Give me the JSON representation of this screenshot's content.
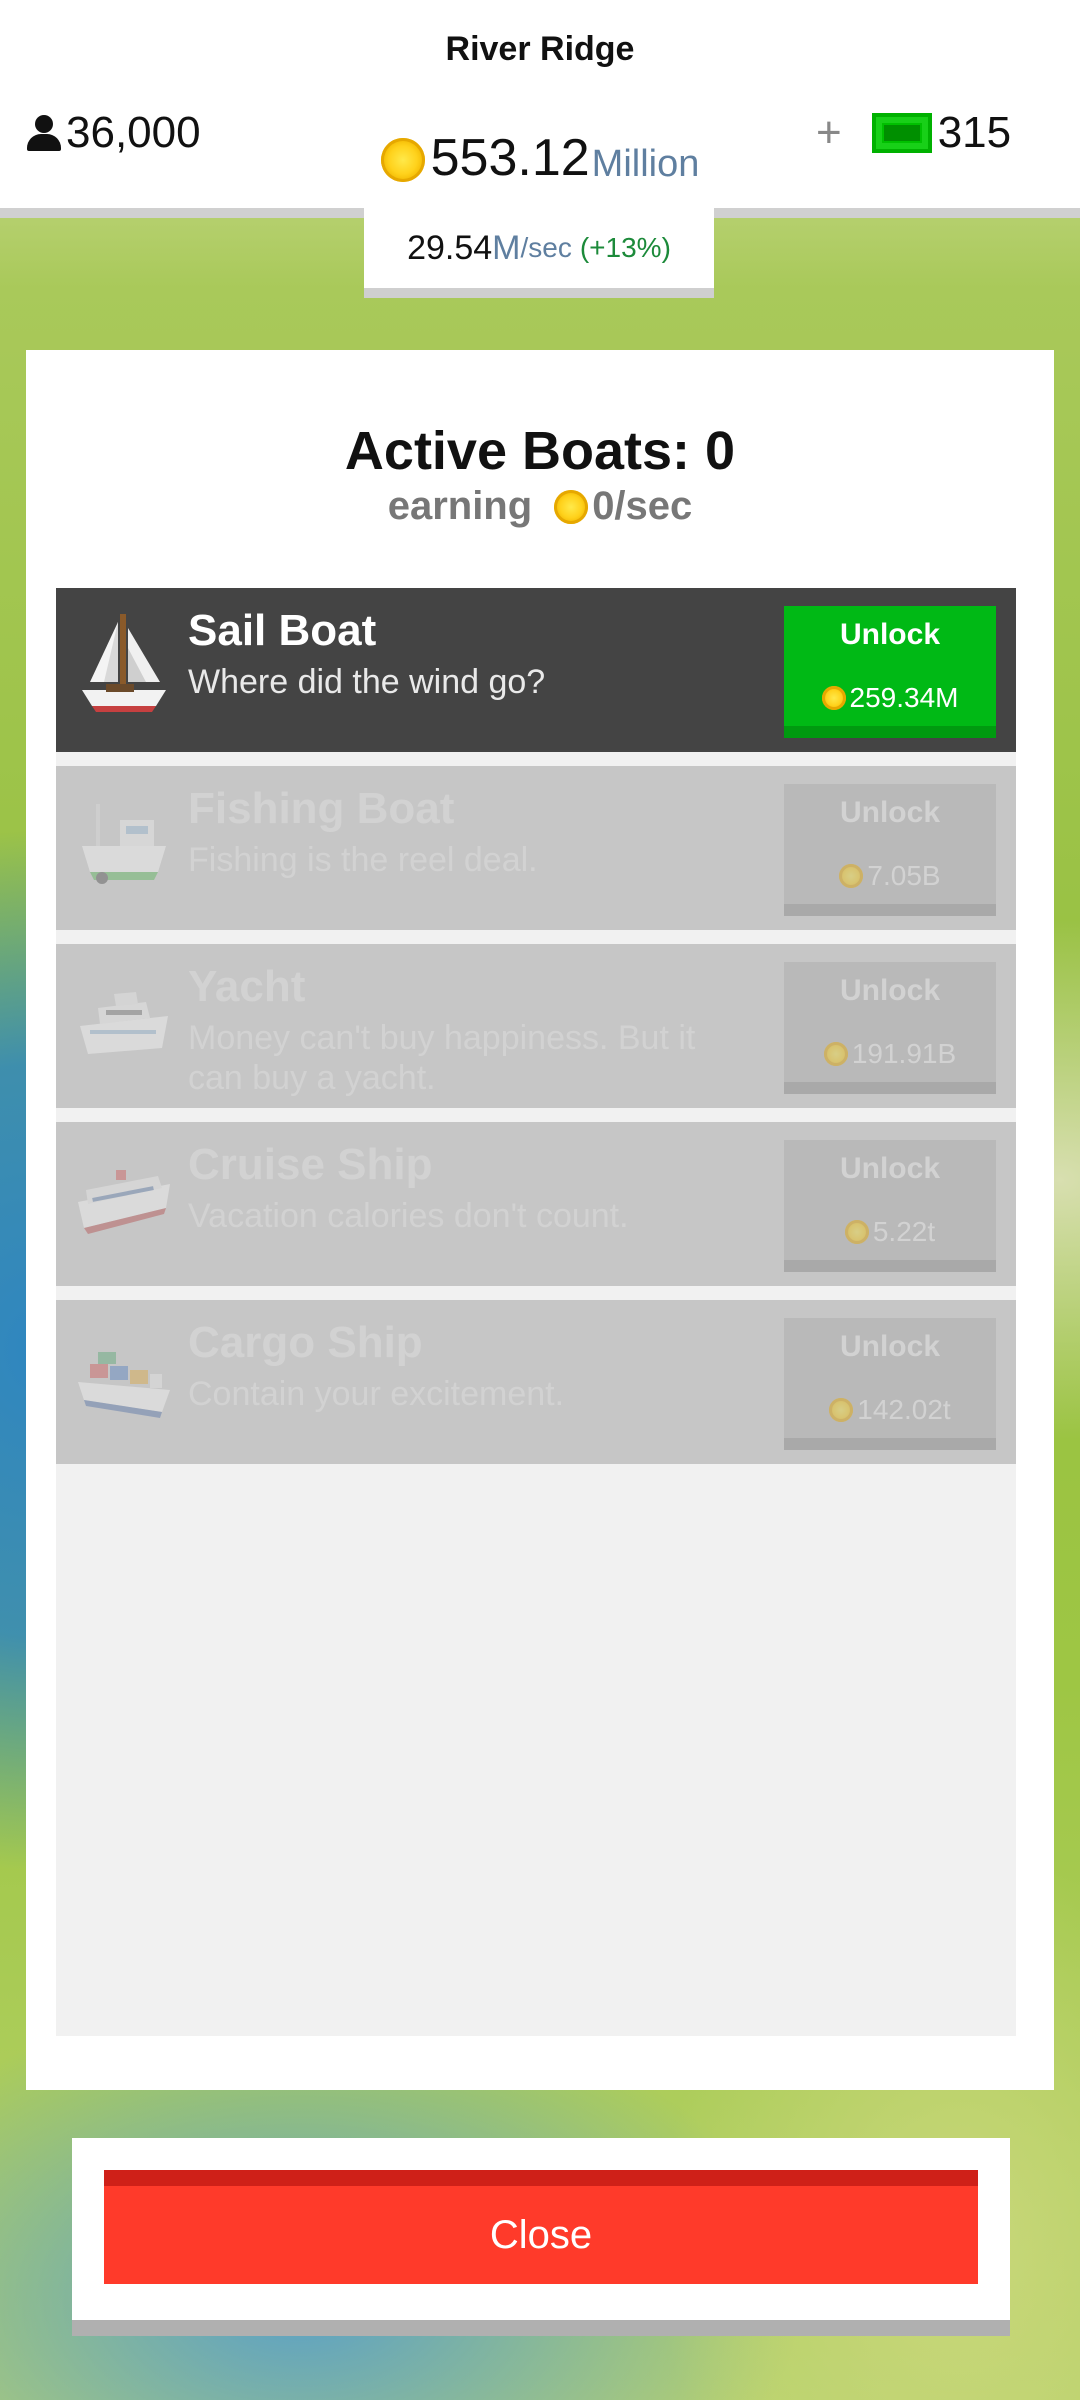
{
  "hud": {
    "town_name": "River Ridge",
    "population": "36,000",
    "cash_amount": "553.12",
    "cash_unit": "Million",
    "gems_plus": "+",
    "gems": "315",
    "rate_value": "29.54",
    "rate_unit": "M",
    "rate_per": "/sec",
    "rate_bonus": "(+13%)",
    "icons": {
      "population": "person-icon",
      "cash": "coin-icon",
      "gems": "cash-note-icon"
    }
  },
  "modal": {
    "title": "Active Boats: 0",
    "earning_label": "earning",
    "earning_value": "0/sec",
    "boats": [
      {
        "name": "Sail Boat",
        "description": "Where did the wind go?",
        "unlock_label": "Unlock",
        "price": "259.34M",
        "state": "available",
        "icon": "sail-boat-icon"
      },
      {
        "name": "Fishing Boat",
        "description": "Fishing is the reel deal.",
        "unlock_label": "Unlock",
        "price": "7.05B",
        "state": "locked",
        "icon": "fishing-boat-icon"
      },
      {
        "name": "Yacht",
        "description": "Money can't buy happiness. But it can buy a yacht.",
        "unlock_label": "Unlock",
        "price": "191.91B",
        "state": "locked",
        "icon": "yacht-icon"
      },
      {
        "name": "Cruise Ship",
        "description": "Vacation calories don't count.",
        "unlock_label": "Unlock",
        "price": "5.22t",
        "state": "locked",
        "icon": "cruise-ship-icon"
      },
      {
        "name": "Cargo Ship",
        "description": "Contain your excitement.",
        "unlock_label": "Unlock",
        "price": "142.02t",
        "state": "locked",
        "icon": "cargo-ship-icon"
      }
    ]
  },
  "close_label": "Close",
  "colors": {
    "unlock_green": "#00b915",
    "close_red": "#ff3a2a",
    "active_row": "#444444",
    "locked_row": "#c6c6c6",
    "coin_gold": "#ffd21c"
  }
}
